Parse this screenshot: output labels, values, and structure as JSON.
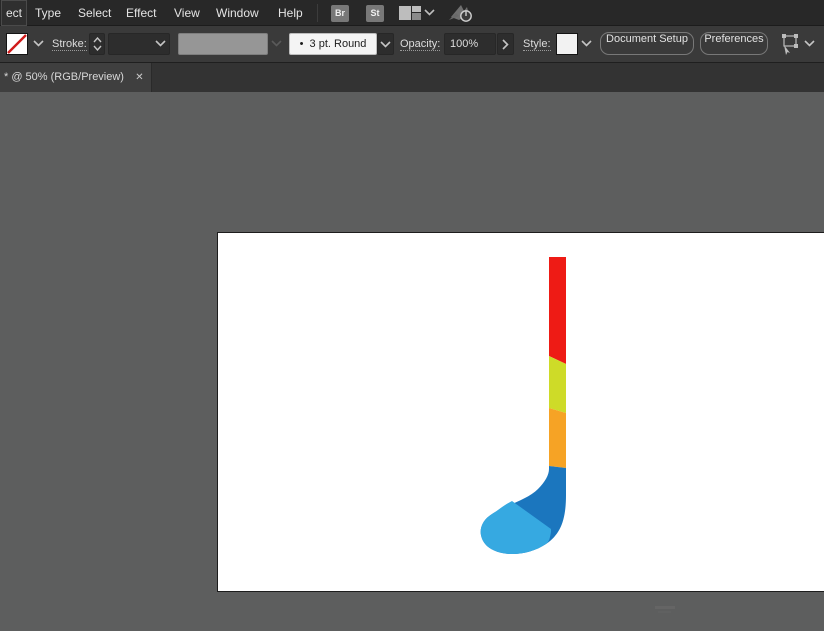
{
  "menu_bar": {
    "items": [
      "ect",
      "Type",
      "Select",
      "Effect",
      "View",
      "Window",
      "Help"
    ],
    "badges": [
      {
        "label": "Br"
      },
      {
        "label": "St"
      }
    ],
    "power_glyph": "⏻"
  },
  "control_bar": {
    "stroke_label": "Stroke:",
    "brush_bullet": "•",
    "brush_name": "3 pt. Round",
    "opacity_label": "Opacity:",
    "opacity_value": "100%",
    "style_label": "Style:",
    "document_setup_label": "Document Setup",
    "preferences_label": "Preferences"
  },
  "tab_bar": {
    "title": "* @ 50% (RGB/Preview)",
    "close_glyph": "✕"
  },
  "artboard": {
    "background": "#ffffff"
  },
  "illustration": {
    "name": "hockey-stick",
    "colors": {
      "red": "#EE1B15",
      "lime": "#CEDB28",
      "orange": "#F6A325",
      "blue_dark": "#1B76BE",
      "blue_light": "#36A9E1"
    }
  }
}
